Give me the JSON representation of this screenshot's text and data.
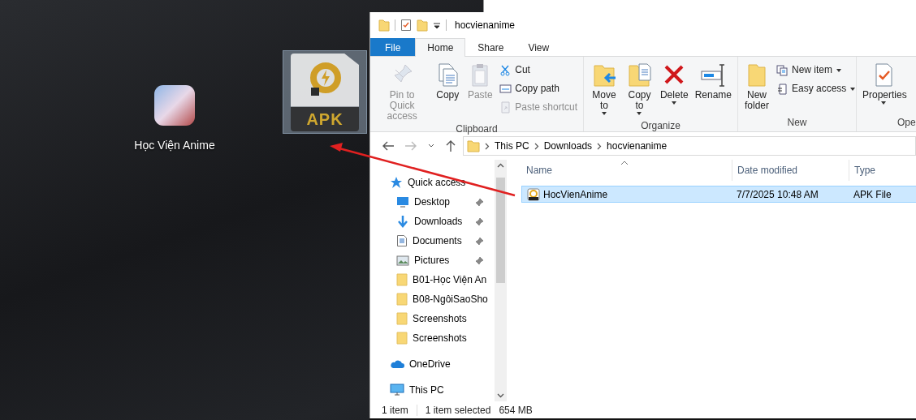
{
  "desktop": {
    "app_label": "Học Viện Anime"
  },
  "drag_ghost": {
    "label": "APK"
  },
  "window": {
    "title": "hocvienanime"
  },
  "ribbon_tabs": [
    {
      "label": "File",
      "selected": false,
      "kind": "backstage"
    },
    {
      "label": "Home",
      "selected": true,
      "kind": "tab"
    },
    {
      "label": "Share",
      "selected": false,
      "kind": "tab"
    },
    {
      "label": "View",
      "selected": false,
      "kind": "tab"
    }
  ],
  "ribbon_groups": [
    {
      "name": "Clipboard",
      "items": [
        {
          "kind": "large",
          "label": "Pin to Quick access",
          "disabled": true,
          "dropdown": false
        },
        {
          "kind": "large",
          "label": "Copy",
          "disabled": false,
          "dropdown": false
        },
        {
          "kind": "large",
          "label": "Paste",
          "disabled": true,
          "dropdown": false
        },
        {
          "kind": "stack",
          "items": [
            {
              "label": "Cut",
              "disabled": false,
              "dropdown": false
            },
            {
              "label": "Copy path",
              "disabled": false,
              "dropdown": false
            },
            {
              "label": "Paste shortcut",
              "disabled": true,
              "dropdown": false
            }
          ]
        }
      ]
    },
    {
      "name": "Organize",
      "items": [
        {
          "kind": "large",
          "label": "Move to",
          "disabled": false,
          "dropdown": true
        },
        {
          "kind": "large",
          "label": "Copy to",
          "disabled": false,
          "dropdown": true
        },
        {
          "kind": "large",
          "label": "Delete",
          "disabled": false,
          "dropdown": true
        },
        {
          "kind": "large",
          "label": "Rename",
          "disabled": false,
          "dropdown": false
        }
      ]
    },
    {
      "name": "New",
      "items": [
        {
          "kind": "large",
          "label": "New folder",
          "disabled": false,
          "dropdown": false
        },
        {
          "kind": "stack",
          "items": [
            {
              "label": "New item",
              "disabled": false,
              "dropdown": true
            },
            {
              "label": "Easy access",
              "disabled": false,
              "dropdown": true
            }
          ]
        }
      ]
    },
    {
      "name": "Ope",
      "items": [
        {
          "kind": "large",
          "label": "Properties",
          "disabled": false,
          "dropdown": true
        }
      ]
    }
  ],
  "address": {
    "crumbs": [
      "This PC",
      "Downloads",
      "hocvienanime"
    ]
  },
  "nav_pane": [
    {
      "label": "Quick access",
      "pinned": false,
      "children": [
        {
          "label": "Desktop",
          "pinned": true
        },
        {
          "label": "Downloads",
          "pinned": true
        },
        {
          "label": "Documents",
          "pinned": true
        },
        {
          "label": "Pictures",
          "pinned": true
        },
        {
          "label": "B01-Học Viện An",
          "pinned": false
        },
        {
          "label": "B08-NgôiSaoSho",
          "pinned": false
        },
        {
          "label": "Screenshots",
          "pinned": false
        },
        {
          "label": "Screenshots",
          "pinned": false
        }
      ]
    },
    {
      "label": "OneDrive",
      "pinned": false
    },
    {
      "label": "This PC",
      "pinned": false
    }
  ],
  "file_list": {
    "columns": [
      "Name",
      "Date modified",
      "Type"
    ],
    "rows": [
      {
        "name": "HocVienAnime",
        "date_modified": "7/7/2025 10:48 AM",
        "type": "APK File",
        "selected": true
      }
    ]
  },
  "status_bar": {
    "count": "1 item",
    "selection": "1 item selected",
    "size": "654 MB"
  }
}
